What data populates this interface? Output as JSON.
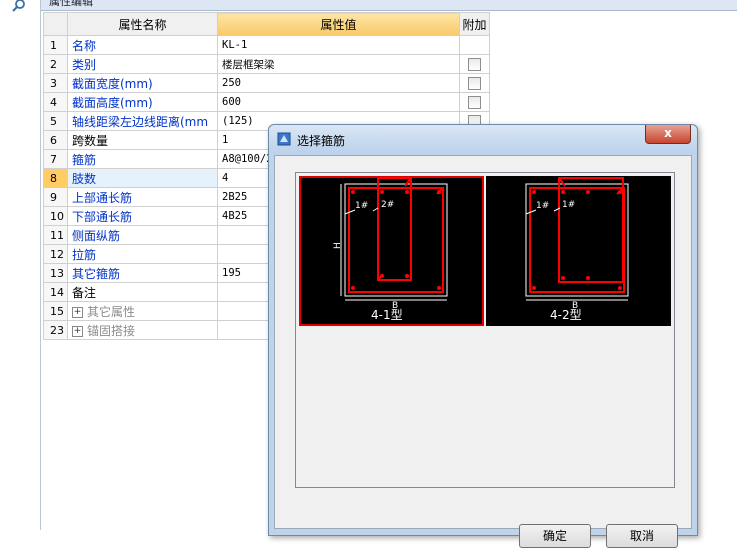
{
  "panel": {
    "tab_title": "属性编辑"
  },
  "grid": {
    "headers": {
      "num": "",
      "name": "属性名称",
      "value": "属性值",
      "extra": "附加"
    },
    "rows": [
      {
        "num": "1",
        "name": "名称",
        "value": "KL-1",
        "checkbox": false
      },
      {
        "num": "2",
        "name": "类别",
        "value": "楼层框架梁",
        "checkbox": true
      },
      {
        "num": "3",
        "name": "截面宽度(mm)",
        "value": "250",
        "checkbox": true
      },
      {
        "num": "4",
        "name": "截面高度(mm)",
        "value": "600",
        "checkbox": true
      },
      {
        "num": "5",
        "name": "轴线距梁左边线距离(mm",
        "value": "(125)",
        "checkbox": true
      },
      {
        "num": "6",
        "name": "跨数量",
        "value": "1",
        "checkbox": false
      },
      {
        "num": "7",
        "name": "箍筋",
        "value": "A8@100/2",
        "checkbox": false
      },
      {
        "num": "8",
        "name": "肢数",
        "value": "4",
        "checkbox": false
      },
      {
        "num": "9",
        "name": "上部通长筋",
        "value": "2B25",
        "checkbox": false
      },
      {
        "num": "10",
        "name": "下部通长筋",
        "value": "4B25",
        "checkbox": false
      },
      {
        "num": "11",
        "name": "侧面纵筋",
        "value": "",
        "checkbox": false
      },
      {
        "num": "12",
        "name": "拉筋",
        "value": "",
        "checkbox": false
      },
      {
        "num": "13",
        "name": "其它箍筋",
        "value": "195",
        "checkbox": false
      },
      {
        "num": "14",
        "name": "备注",
        "value": "",
        "checkbox": false
      },
      {
        "num": "15",
        "name": "其它属性",
        "value": "",
        "checkbox": false
      },
      {
        "num": "23",
        "name": "锚固搭接",
        "value": "",
        "checkbox": false
      }
    ]
  },
  "dialog": {
    "title": "选择箍筋",
    "close_label": "x",
    "items": [
      {
        "label": "4-1型",
        "h_label": "H",
        "b_label": "B",
        "tag1": "1#",
        "tag2": "2#"
      },
      {
        "label": "4-2型",
        "b_label": "B",
        "tag1": "1#",
        "tag2": "1#"
      }
    ],
    "ok_label": "确定",
    "cancel_label": "取消"
  },
  "colors": {
    "accent_selected": "#ffcc66",
    "stirrup_red": "#ff0000",
    "link_blue": "#0032c8"
  }
}
